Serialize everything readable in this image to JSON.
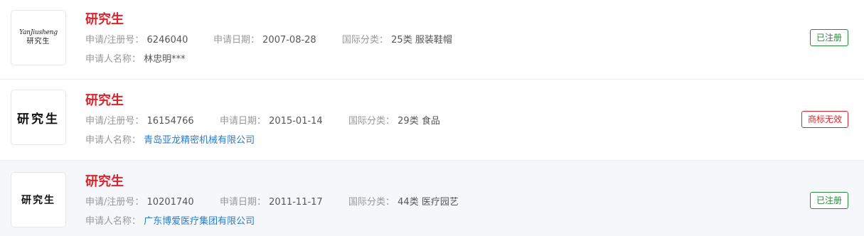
{
  "labels": {
    "reg_no": "申请/注册号：",
    "apply_date": "申请日期：",
    "intl_class": "国际分类：",
    "applicant": "申请人名称："
  },
  "items": [
    {
      "logo_script": "YanJiusheng",
      "logo_cn": "研究生",
      "title": "研究生",
      "reg_no": "6246040",
      "apply_date": "2007-08-28",
      "intl_class": "25类 服装鞋帽",
      "applicant": "林忠明***",
      "status": "已注册",
      "status_color": "#2a8a3e"
    },
    {
      "logo_cn": "研究生",
      "title": "研究生",
      "reg_no": "16154766",
      "apply_date": "2015-01-14",
      "intl_class": "29类 食品",
      "applicant": "青岛亚龙精密机械有限公司",
      "status": "商标无效",
      "status_color": "#d7262d"
    },
    {
      "logo_cn": "研究生",
      "title": "研究生",
      "reg_no": "10201740",
      "apply_date": "2011-11-17",
      "intl_class": "44类 医疗园艺",
      "applicant": "广东博爱医疗集团有限公司",
      "status": "已注册",
      "status_color": "#2a8a3e"
    }
  ]
}
